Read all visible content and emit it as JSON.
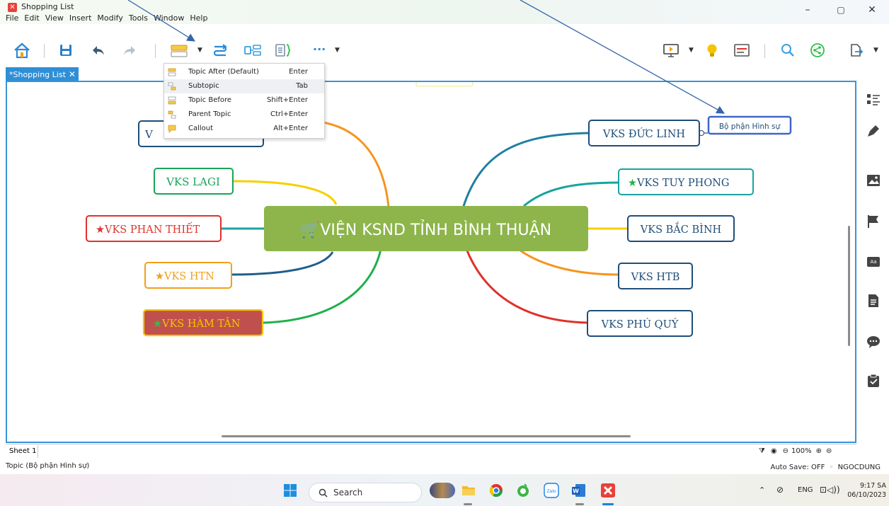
{
  "window": {
    "title": "Shopping List",
    "minimize": "–",
    "maximize": "▢",
    "close": "✕"
  },
  "menu": [
    "File",
    "Edit",
    "View",
    "Insert",
    "Modify",
    "Tools",
    "Window",
    "Help"
  ],
  "toolbar": {
    "more": "···",
    "icons": [
      "home-icon",
      "save-icon",
      "undo-icon",
      "redo-icon",
      "topic-icon",
      "relationship-icon",
      "summary-icon",
      "boundary-icon",
      "more-icon",
      "presentation-icon",
      "idea-icon",
      "outline-icon",
      "search-icon",
      "share-icon",
      "export-icon"
    ]
  },
  "tab": {
    "label": "*Shopping List",
    "close": "✕"
  },
  "dropdown": {
    "items": [
      {
        "label": "Topic After (Default)",
        "key": "Enter"
      },
      {
        "label": "Subtopic",
        "key": "Tab"
      },
      {
        "label": "Topic Before",
        "key": "Shift+Enter"
      },
      {
        "label": "Parent Topic",
        "key": "Ctrl+Enter"
      },
      {
        "label": "Callout",
        "key": "Alt+Enter"
      }
    ],
    "highlighted_index": 1
  },
  "mindmap": {
    "central": "VIỆN KSND TỈNH BÌNH THUẬN",
    "central_icon": "shopping-cart-icon",
    "central_color": "#8db54b",
    "left_topics": [
      {
        "text": "V",
        "color": "#1f4e79",
        "star": false
      },
      {
        "text": "VKS LAGI",
        "color": "#1aa35a",
        "star": false
      },
      {
        "text": "VKS PHAN THIẾT",
        "color": "#e0312a",
        "star": true,
        "star_color": "#e0312a"
      },
      {
        "text": "VKS HTN",
        "color": "#f2a01a",
        "star": true,
        "star_color": "#f2a01a"
      },
      {
        "text": "VKS HÀM TÂN",
        "color": "#f5c400",
        "star": true,
        "star_color": "#2fbf4a",
        "fill": "#c0504d"
      }
    ],
    "right_topics": [
      {
        "text": "VKS ĐỨC LINH",
        "color": "#1f4e79",
        "star": false
      },
      {
        "text": "VKS TUY PHONG",
        "color": "#1f4e79",
        "star": true,
        "star_color": "#1fb34a"
      },
      {
        "text": "VKS BẮC BÌNH",
        "color": "#1f4e79",
        "star": false
      },
      {
        "text": "VKS HTB",
        "color": "#1f4e79",
        "star": false
      },
      {
        "text": "VKS PHÚ QUÝ",
        "color": "#1f4e79",
        "star": false
      }
    ],
    "subtopic": {
      "text": "Bộ phận Hình sự",
      "color": "#3f66c8"
    }
  },
  "sheet": {
    "tab": "Sheet 1",
    "zoom": "100%"
  },
  "status": {
    "left": "Topic (Bộ phận Hình sự)",
    "autosave": "Auto Save: OFF",
    "user": "NGOCDUNG"
  },
  "taskbar": {
    "search": "Search",
    "lang": "ENG",
    "time": "9:17 SA",
    "date": "06/10/2023"
  },
  "colors": {
    "accent": "#2f8fd6",
    "canvas_border": "#3b94d6"
  }
}
